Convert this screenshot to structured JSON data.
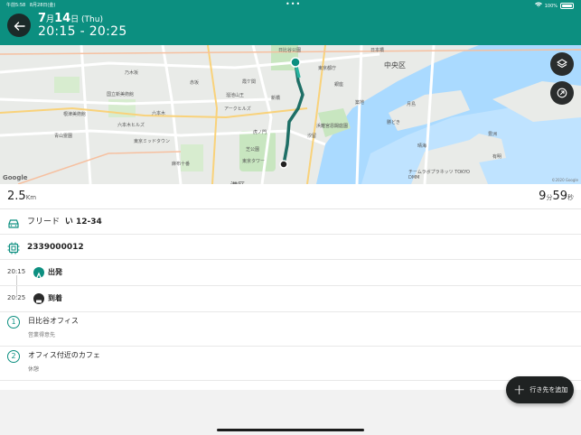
{
  "status_bar": {
    "time": "午前5:58",
    "date": "8月28日(金)",
    "battery": "100%"
  },
  "header": {
    "month": "7",
    "month_unit": "月",
    "day": "14",
    "day_unit": "日",
    "weekday": "(Thu)",
    "time_range": "20:15 - 20:25",
    "background_color": "#0c8f80"
  },
  "map": {
    "labels": [
      "日比谷公園",
      "中央区",
      "東京都庁",
      "港区",
      "国立新美術館",
      "乃木坂",
      "六本木",
      "根津美術館",
      "六本木ヒルズ",
      "東京ミッドタウン",
      "アークヒルズ",
      "溜池山王",
      "霞ケ関",
      "赤坂",
      "麻布十番",
      "青山霊園",
      "虎ノ門",
      "汐留",
      "浜離宮恩賜庭園",
      "チームラボプラネッツ TOKYO DMM",
      "晴海",
      "月島",
      "勝どき",
      "築地",
      "銀座",
      "新橋",
      "芝公園",
      "東京タワー",
      "日本橋",
      "有明",
      "豊洲"
    ],
    "google_label": "Google",
    "copyright": "©2020 Google",
    "layers_icon": "layers-icon",
    "share_icon": "open-external-icon"
  },
  "summary": {
    "distance": "2.5",
    "distance_unit": "Km",
    "minutes": "9",
    "minutes_unit": "分",
    "seconds": "59",
    "seconds_unit": "秒"
  },
  "vehicle": {
    "name": "フリード",
    "plate": "い 12-34"
  },
  "device": {
    "id": "2339000012"
  },
  "timeline": [
    {
      "time": "20:15",
      "label": "出発"
    },
    {
      "time": "20:25",
      "label": "到着"
    }
  ],
  "destinations": [
    {
      "number": "1",
      "name": "日比谷オフィス",
      "sub": "営業得意先"
    },
    {
      "number": "2",
      "name": "オフィス付近のカフェ",
      "sub": "休憩"
    }
  ],
  "add_button": {
    "label": "行き先を追加"
  }
}
